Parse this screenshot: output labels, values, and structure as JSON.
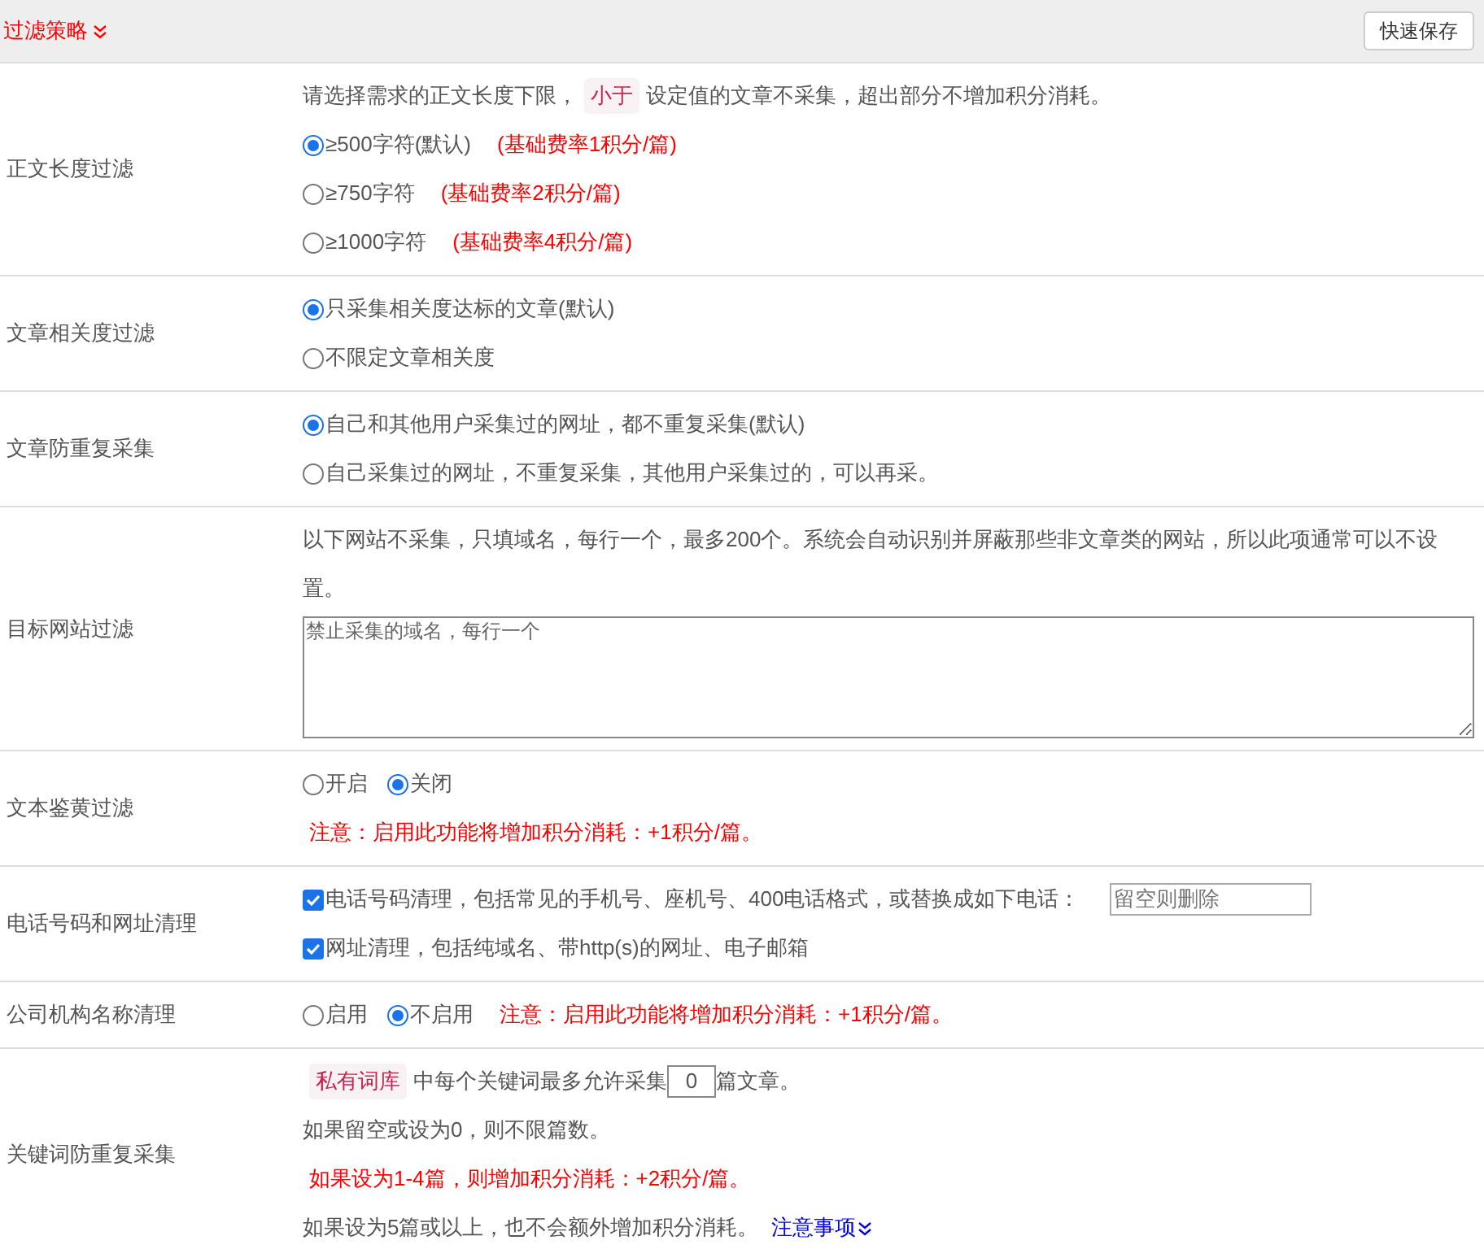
{
  "header": {
    "title": "过滤策略",
    "save_button": "快速保存"
  },
  "rows": [
    {
      "label": "正文长度过滤",
      "lines": [
        [
          {
            "kind": "text",
            "text": "请选择需求的正文长度下限，"
          },
          {
            "kind": "tag",
            "text": "小于"
          },
          {
            "kind": "text",
            "text": "设定值的文章不采集，超出部分不增加积分消耗。"
          }
        ],
        [
          {
            "kind": "radio",
            "label": "≥500字符(默认)",
            "selected": true
          },
          {
            "kind": "note",
            "text": "(基础费率1积分/篇)"
          }
        ],
        [
          {
            "kind": "radio",
            "label": "≥750字符",
            "selected": false
          },
          {
            "kind": "note",
            "text": "(基础费率2积分/篇)"
          }
        ],
        [
          {
            "kind": "radio",
            "label": "≥1000字符",
            "selected": false
          },
          {
            "kind": "note",
            "text": "(基础费率4积分/篇)"
          }
        ]
      ]
    },
    {
      "label": "文章相关度过滤",
      "lines": [
        [
          {
            "kind": "radio",
            "label": "只采集相关度达标的文章(默认)",
            "selected": true
          }
        ],
        [
          {
            "kind": "radio",
            "label": "不限定文章相关度",
            "selected": false
          }
        ]
      ]
    },
    {
      "label": "文章防重复采集",
      "lines": [
        [
          {
            "kind": "radio",
            "label": "自己和其他用户采集过的网址，都不重复采集(默认)",
            "selected": true
          }
        ],
        [
          {
            "kind": "radio",
            "label": "自己采集过的网址，不重复采集，其他用户采集过的，可以再采。",
            "selected": false
          }
        ]
      ]
    },
    {
      "label": "目标网站过滤",
      "lines": [
        [
          {
            "kind": "text",
            "text": "以下网站不采集，只填域名，每行一个，最多200个。系统会自动识别并屏蔽那些非文章类的网站，所以此项通常可以不设置。"
          }
        ],
        [
          {
            "kind": "textarea",
            "placeholder": "禁止采集的域名，每行一个"
          }
        ]
      ]
    },
    {
      "label": "文本鉴黄过滤",
      "lines": [
        [
          {
            "kind": "radio",
            "label": "开启",
            "selected": false
          },
          {
            "kind": "radio",
            "label": "关闭",
            "selected": true
          }
        ],
        [
          {
            "kind": "note",
            "text": "注意：启用此功能将增加积分消耗：+1积分/篇。"
          }
        ]
      ]
    },
    {
      "label": "电话号码和网址清理",
      "lines": [
        [
          {
            "kind": "checkbox",
            "label": "电话号码清理，包括常见的手机号、座机号、400电话格式，或替换成如下电话：",
            "checked": true
          },
          {
            "kind": "input",
            "placeholder": "留空则删除"
          }
        ],
        [
          {
            "kind": "checkbox",
            "label": "网址清理，包括纯域名、带http(s)的网址、电子邮箱",
            "checked": true
          }
        ]
      ]
    },
    {
      "label": "公司机构名称清理",
      "lines": [
        [
          {
            "kind": "radio",
            "label": "启用",
            "selected": false
          },
          {
            "kind": "radio",
            "label": "不启用",
            "selected": true
          },
          {
            "kind": "note",
            "text": "注意：启用此功能将增加积分消耗：+1积分/篇。"
          }
        ]
      ]
    },
    {
      "label": "关键词防重复采集",
      "lines": [
        [
          {
            "kind": "tag",
            "text": "私有词库"
          },
          {
            "kind": "text",
            "text": "中每个关键词最多允许采集"
          },
          {
            "kind": "number",
            "value": "0"
          },
          {
            "kind": "text",
            "text": "篇文章。"
          }
        ],
        [
          {
            "kind": "text",
            "text": "如果留空或设为0，则不限篇数。"
          }
        ],
        [
          {
            "kind": "note",
            "text": "如果设为1-4篇，则增加积分消耗：+2积分/篇。"
          }
        ],
        [
          {
            "kind": "text",
            "text": "如果设为5篇或以上，也不会额外增加积分消耗。"
          },
          {
            "kind": "link",
            "text": "注意事项"
          }
        ]
      ]
    }
  ]
}
